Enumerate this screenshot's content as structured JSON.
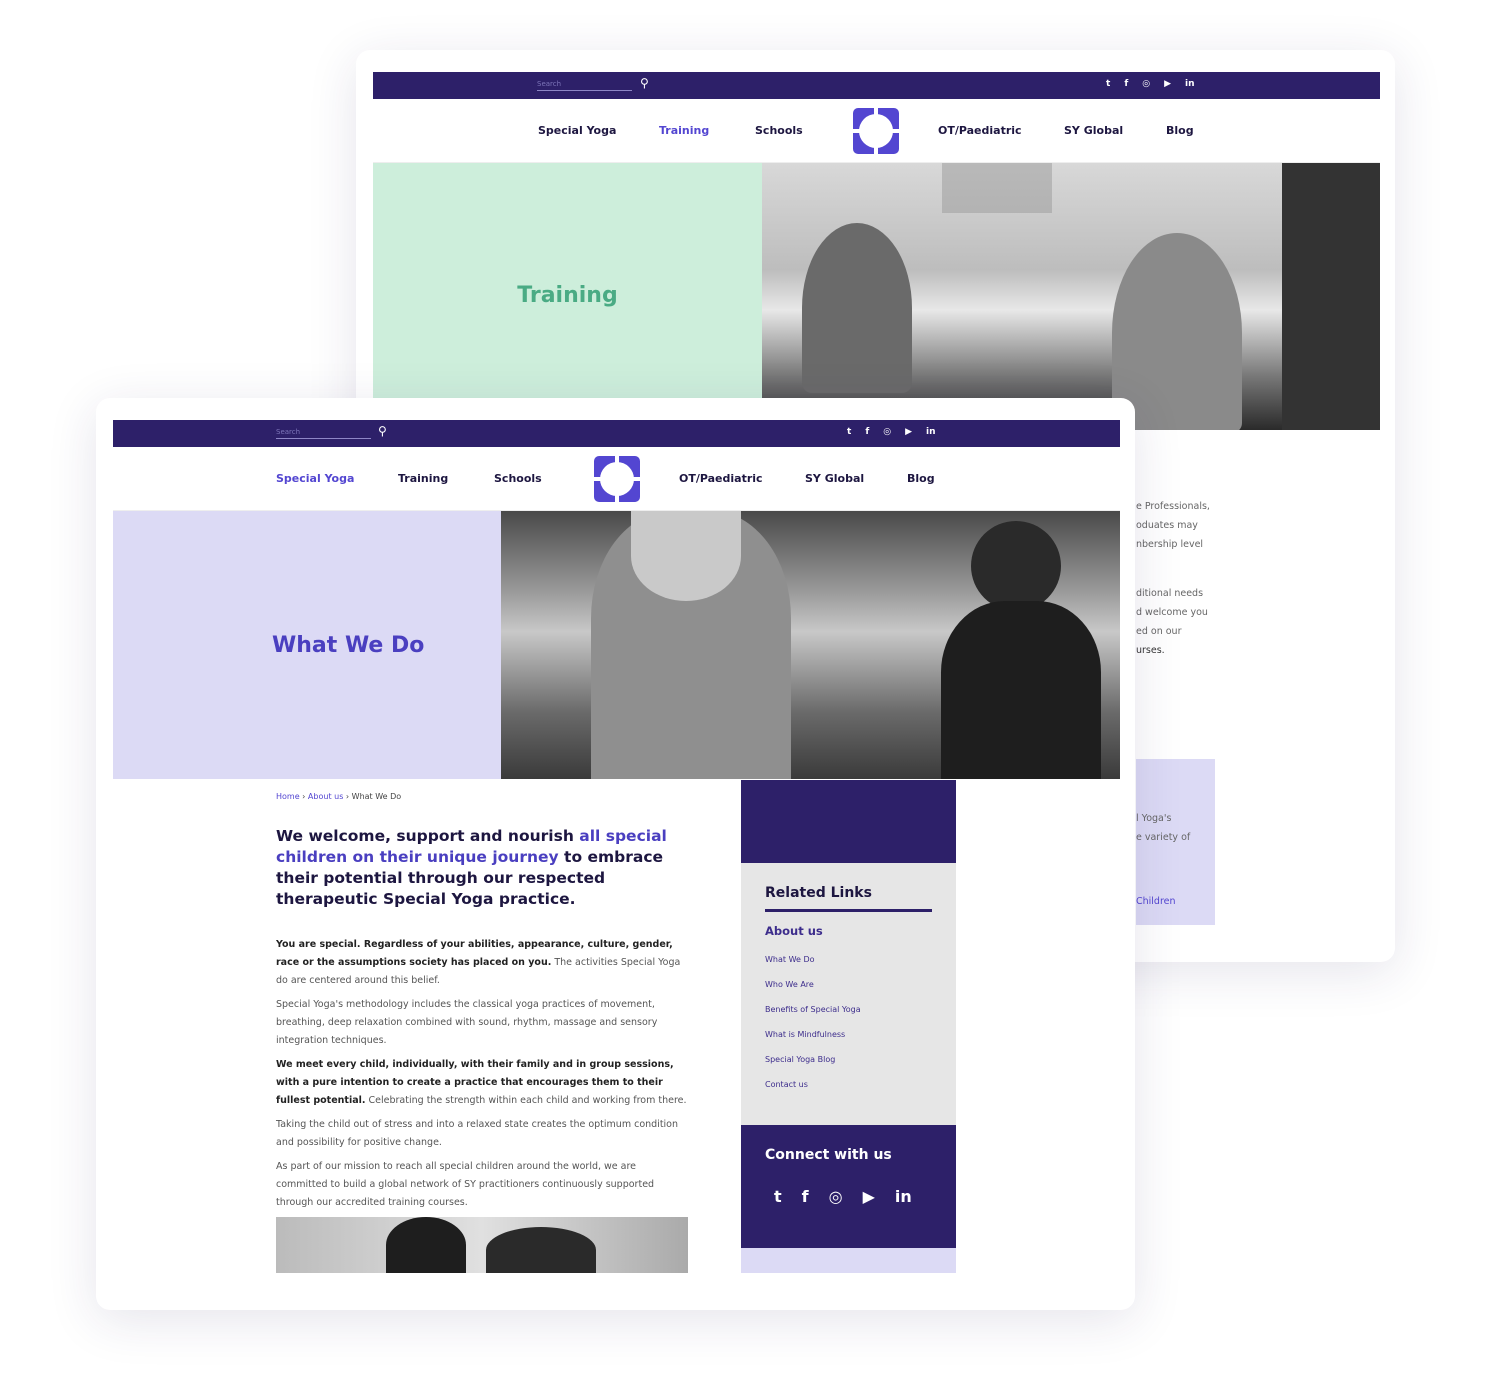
{
  "colors": {
    "navy": "#2d2069",
    "accent": "#5346d1",
    "mint": "#cdeedb",
    "mint_text": "#4aab84",
    "lavender": "#dcdaf5"
  },
  "social_icons": [
    "twitter-icon",
    "facebook-icon",
    "instagram-icon",
    "youtube-icon",
    "linkedin-icon"
  ],
  "back": {
    "search_placeholder": "Search",
    "nav": [
      "Special Yoga",
      "Training",
      "Schools",
      "OT/Paediatric",
      "SY Global",
      "Blog"
    ],
    "active_nav": "Training",
    "hero_title": "Training",
    "fragments": [
      "e Professionals,",
      "oduates may",
      "nbership level",
      "ditional needs",
      "d welcome you",
      "ed on our",
      "urses."
    ],
    "box_fragments": [
      "l Yoga's",
      "e variety of"
    ],
    "box_link": "Children"
  },
  "front": {
    "search_placeholder": "Search",
    "nav": [
      "Special Yoga",
      "Training",
      "Schools",
      "OT/Paediatric",
      "SY Global",
      "Blog"
    ],
    "active_nav": "Special Yoga",
    "hero_title": "What We Do",
    "breadcrumb": [
      "Home",
      "About us",
      "What We Do"
    ],
    "intro": {
      "a": "We welcome, support and nourish ",
      "b": "all special children on their unique journey",
      "c": " to embrace their potential through our respected therapeutic Special Yoga practice."
    },
    "paragraphs": [
      {
        "bold": "You are special. Regardless of your abilities, appearance, culture, gender, race or the assumptions society has placed on you.",
        "text": " The activities Special Yoga do are centered around this belief."
      },
      {
        "bold": "",
        "text": "Special Yoga's methodology includes the classical yoga practices of movement, breathing, deep relaxation combined with sound, rhythm, massage and sensory integration techniques."
      },
      {
        "bold": "We meet every child, individually, with their family and in group sessions, with a pure intention to create a practice that encourages them to their fullest potential.",
        "text": " Celebrating the strength within each child and working from there."
      },
      {
        "bold": "",
        "text": "Taking the child out of stress and into a relaxed state creates the optimum condition and possibility for positive change."
      },
      {
        "bold": "",
        "text": "As part of our mission to reach all special children around the world, we are committed to build a global network of SY practitioners continuously supported through our accredited training courses."
      }
    ],
    "sidebar": {
      "related_title": "Related Links",
      "section": "About us",
      "links": [
        "What We Do",
        "Who We Are",
        "Benefits of Special Yoga",
        "What is Mindfulness",
        "Special Yoga Blog",
        "Contact us"
      ],
      "connect_title": "Connect with us"
    }
  }
}
